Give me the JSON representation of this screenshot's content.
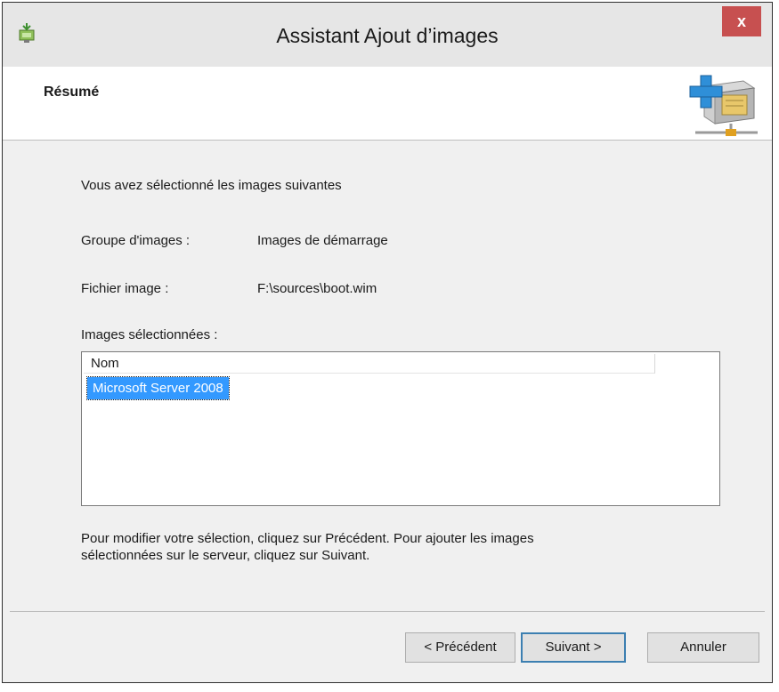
{
  "window": {
    "title": "Assistant Ajout d’images",
    "close_label": "x"
  },
  "header": {
    "page_title": "Résumé"
  },
  "content": {
    "intro": "Vous avez sélectionné les images suivantes",
    "image_group": {
      "label": "Groupe d'images :",
      "value": "Images de démarrage"
    },
    "image_file": {
      "label": "Fichier image :",
      "value": "F:\\sources\\boot.wim"
    },
    "selected_images": {
      "label": "Images sélectionnées :",
      "column_header": "Nom",
      "items": [
        "Microsoft Server 2008"
      ]
    },
    "help_text_line1": "Pour modifier votre sélection, cliquez sur Précédent. Pour ajouter les images",
    "help_text_line2": "sélectionnées sur le serveur, cliquez sur Suivant."
  },
  "buttons": {
    "previous": "< Précédent",
    "next": "Suivant >",
    "cancel": "Annuler"
  },
  "colors": {
    "selection": "#3399ff",
    "close_button": "#c75050",
    "default_button_border": "#3c7fb1"
  },
  "icons": {
    "app": "wds-server-icon",
    "header": "add-image-box-icon",
    "close": "close-icon"
  }
}
